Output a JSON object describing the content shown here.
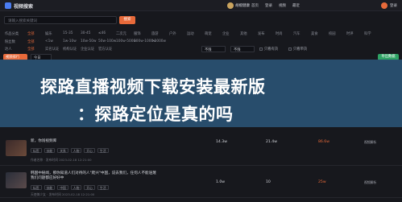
{
  "topbar": {
    "brand": "视频搜索",
    "user": "胡椒健康",
    "nav": [
      "首页",
      "登录",
      "视频",
      "最近"
    ],
    "right_label": "登录"
  },
  "search": {
    "placeholder": "请输入搜索关键词",
    "button": "搜索"
  },
  "filters": [
    {
      "label": "作品分类",
      "items": [
        "全部",
        "娱乐",
        "15-35",
        "30-45",
        "≤46",
        "二次元",
        "服饰",
        "旅游",
        "户外",
        "运动",
        "萌宠",
        "企业",
        "其他",
        "发布",
        "时尚",
        "汽车",
        "美食",
        "校园",
        "时评",
        "科学"
      ]
    },
    {
      "label": "粉丝数",
      "items": [
        "全部",
        "<1w",
        "1w-10w",
        "10w-50w",
        "50w-100w",
        "100w-500w",
        "500w-1000w",
        ">1000w"
      ]
    },
    {
      "label": "达人",
      "items": [
        "全部",
        "实名认证",
        "机构认证",
        "企业认证",
        "官方认证"
      ]
    }
  ],
  "selects": [
    "不限",
    "不限"
  ],
  "checks": [
    "只看有货",
    "只看带货"
  ],
  "tab_active": "视频排行",
  "tab_select": "今日",
  "export_label": "导出数据",
  "overlay": {
    "line1": "探路直播视频下载安装最新版",
    "line2": "：探路定位是真的吗"
  },
  "rows": [
    {
      "title": "新，你闯视频库",
      "tags": [
        "标签",
        "技能",
        "关系",
        "人物",
        "开心",
        "生活"
      ],
      "meta": "作者名称 · 发布时间 2023-02-18 12:21:00",
      "likes": "14.3w",
      "comments": "21.4w",
      "hot": "86.6w",
      "action": "视频解析"
    },
    {
      "title": "韩国中秘闻，那你知道人们对待的人\"爬兴\"中国，说去我们，任何人不能诬蔑我们问题都应好好中",
      "tags": [
        "标签",
        "技能",
        "中国",
        "人物",
        "开心",
        "生活"
      ],
      "meta": "天使美少女 · 发布时间 2023-02-18 12:21:00",
      "likes": "1.0w",
      "comments": "10",
      "hot": "25w",
      "action": "视频解析"
    }
  ],
  "colors": {
    "accent": "#e86a3a",
    "export": "#2fa365",
    "banner": "#2a4f6f",
    "background": "#17181d"
  }
}
